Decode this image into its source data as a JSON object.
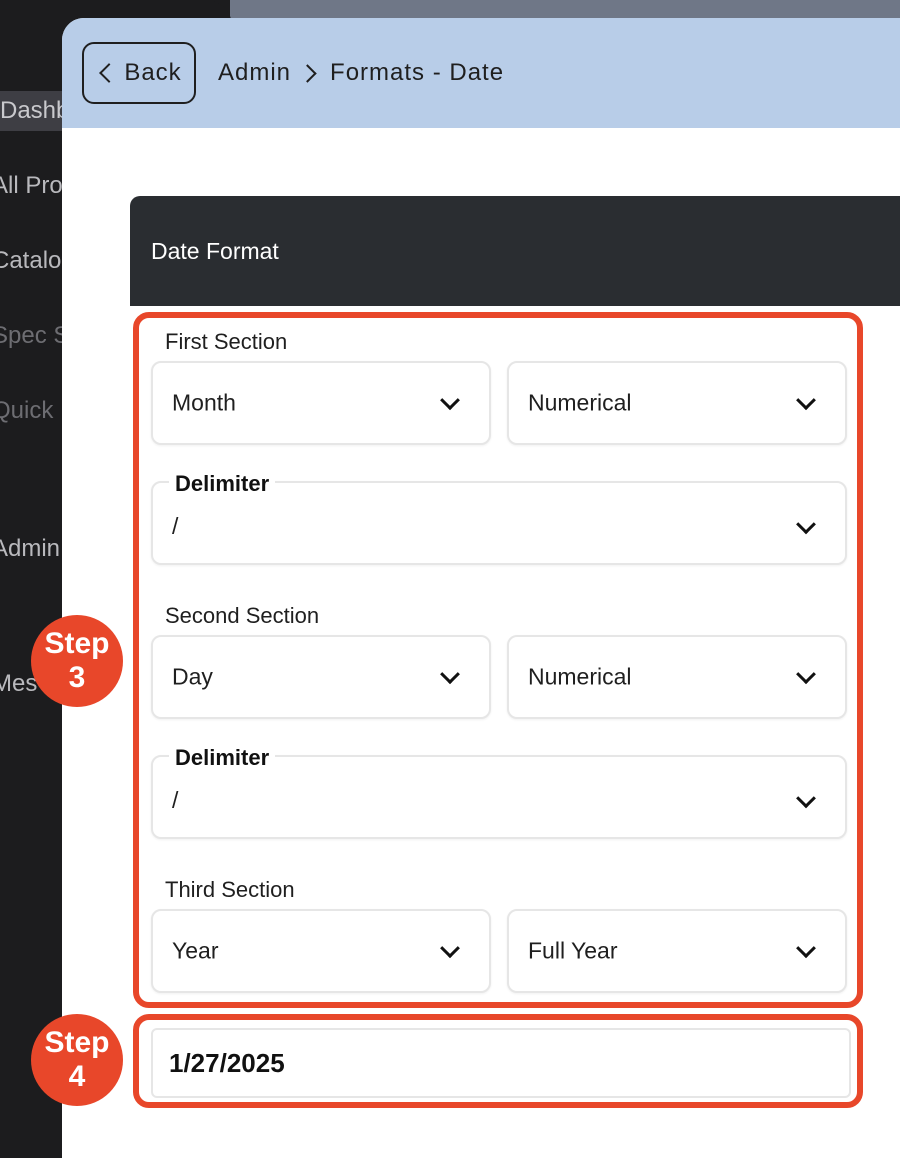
{
  "sidebar": {
    "items": [
      {
        "label": "Dashb"
      },
      {
        "label": "All Pro"
      },
      {
        "label": "Catalo"
      },
      {
        "label": "Spec S"
      },
      {
        "label": "Quick"
      },
      {
        "label": "Admin"
      },
      {
        "label": "Mes"
      }
    ]
  },
  "header": {
    "back_label": "Back",
    "breadcrumb": [
      "Admin",
      "Formats - Date"
    ]
  },
  "card": {
    "title": "Date Format"
  },
  "sections": [
    {
      "label": "First Section",
      "component": "Month",
      "style": "Numerical",
      "delimiter_label": "Delimiter",
      "delimiter": "/"
    },
    {
      "label": "Second Section",
      "component": "Day",
      "style": "Numerical",
      "delimiter_label": "Delimiter",
      "delimiter": "/"
    },
    {
      "label": "Third Section",
      "component": "Year",
      "style": "Full Year"
    }
  ],
  "preview": {
    "value": "1/27/2025"
  },
  "annotations": {
    "step3": {
      "word": "Step",
      "number": "3"
    },
    "step4": {
      "word": "Step",
      "number": "4"
    },
    "color": "#e8472a"
  }
}
